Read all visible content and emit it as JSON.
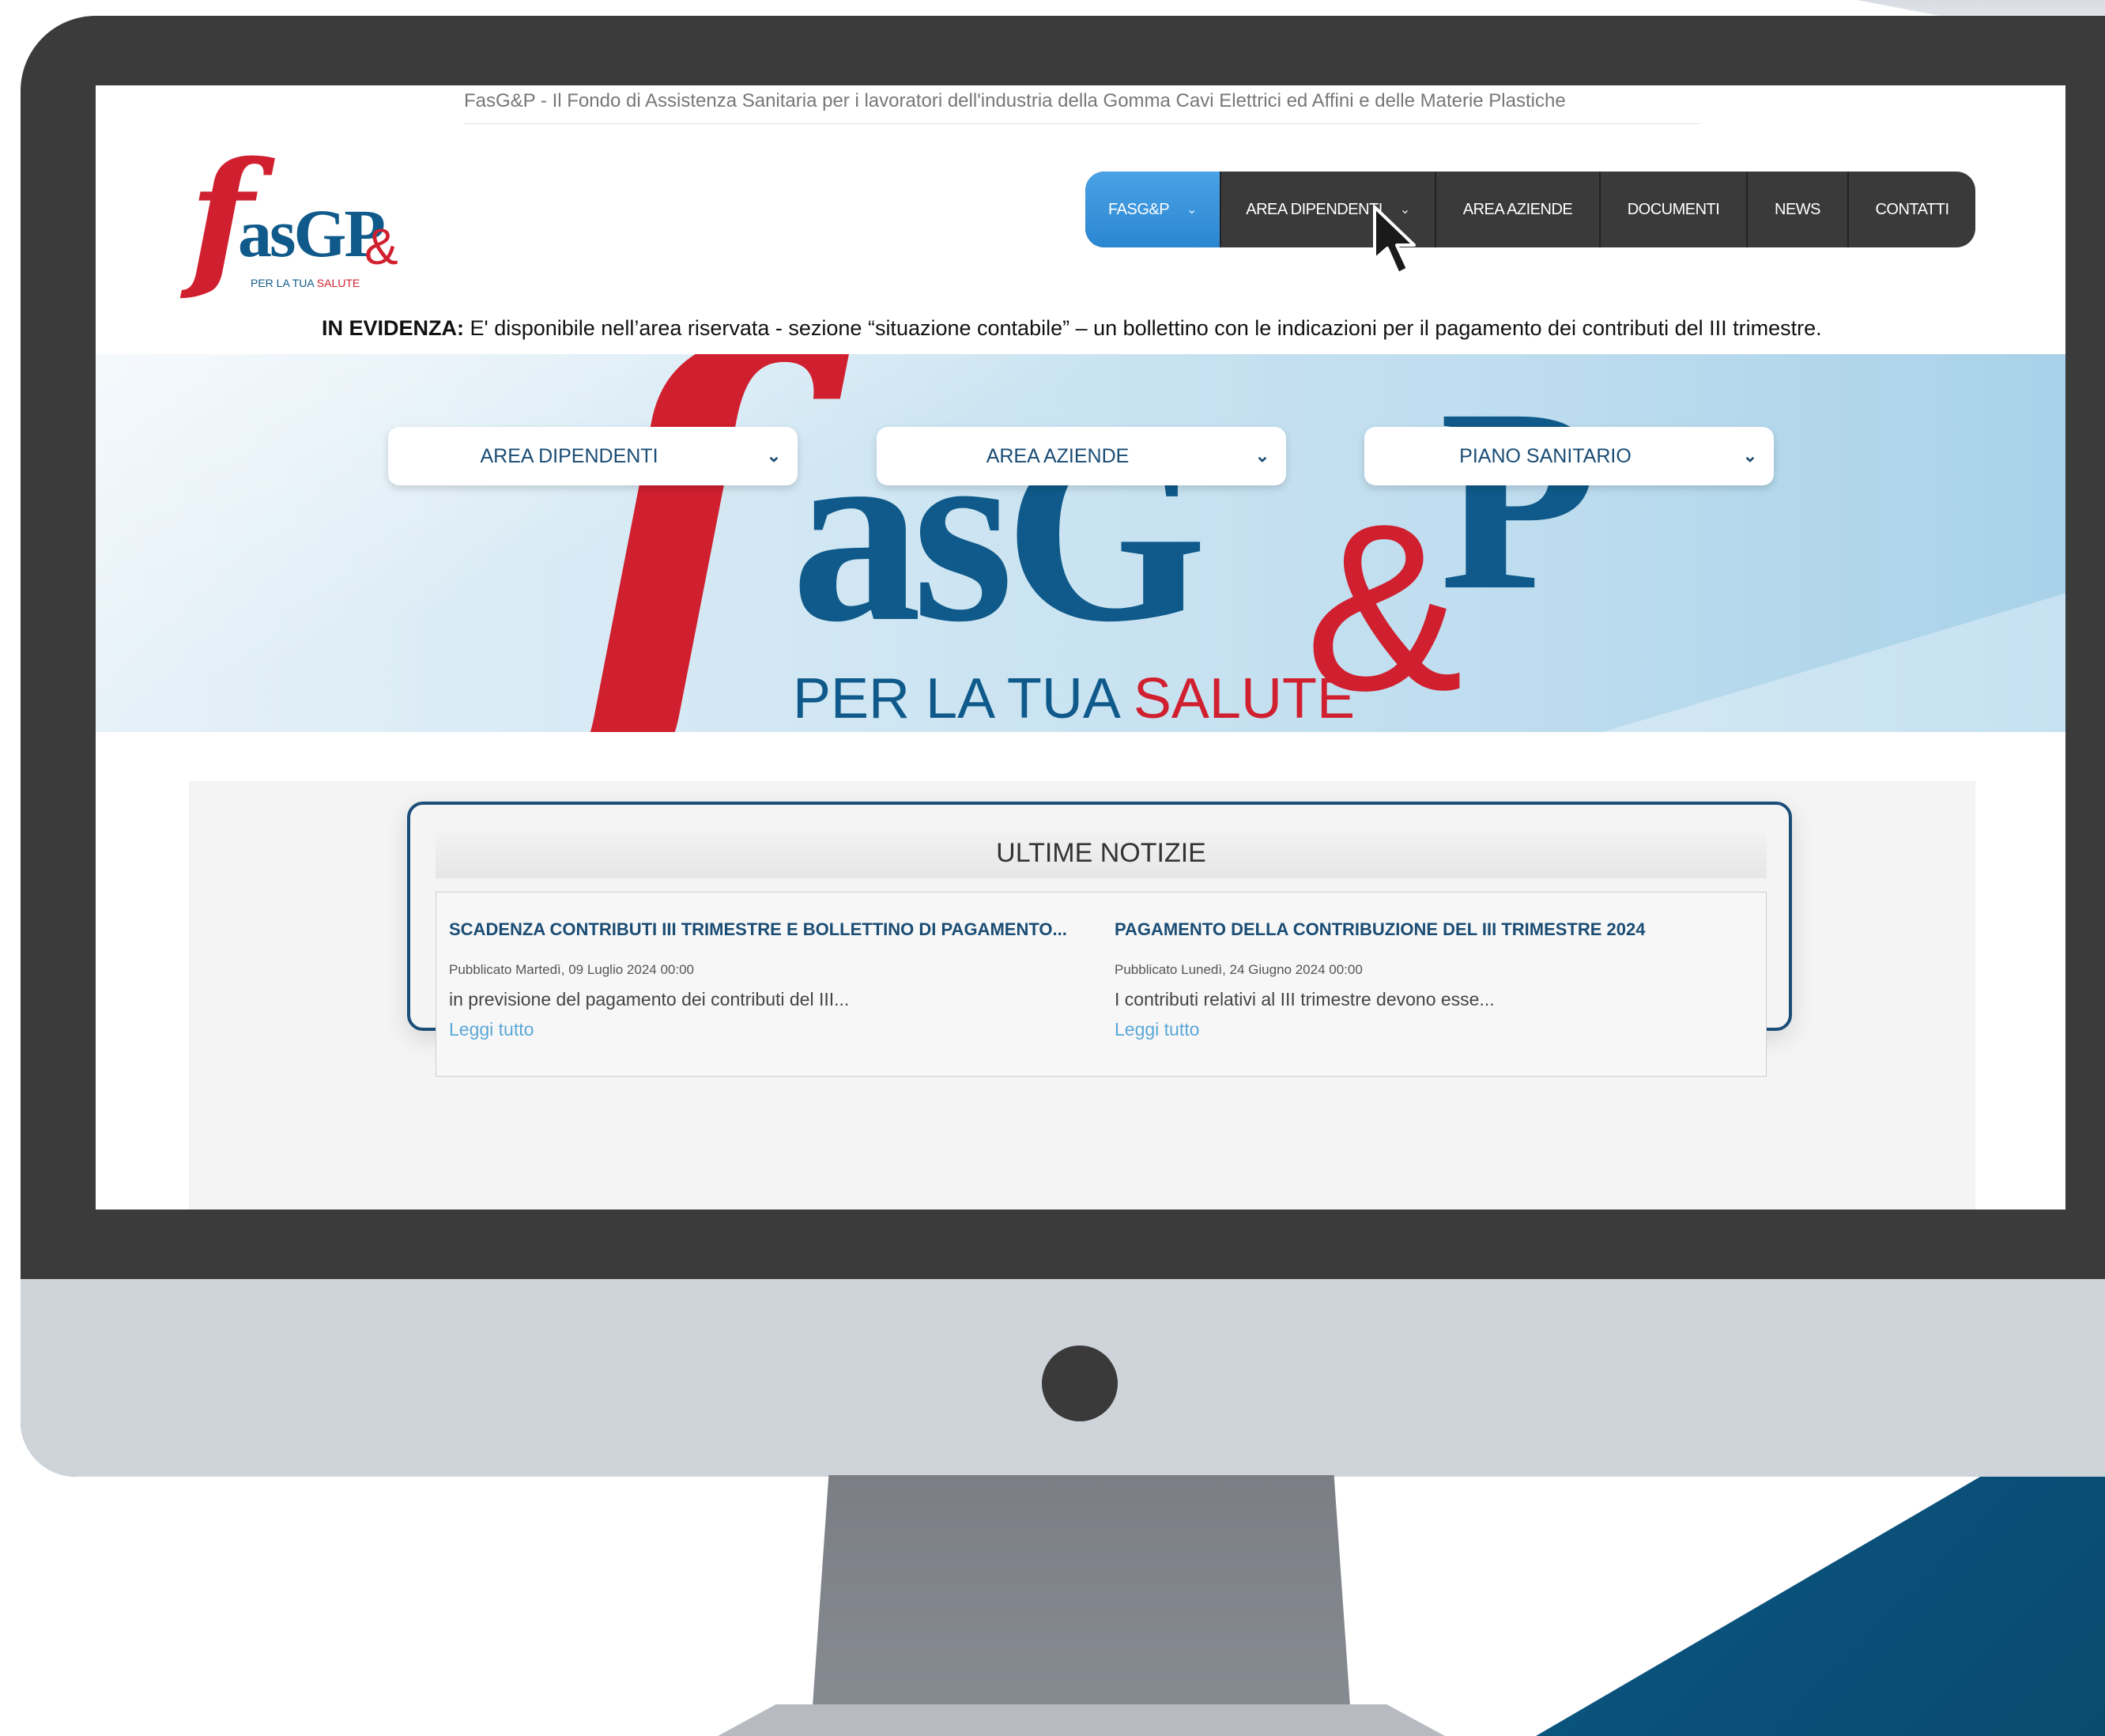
{
  "site": {
    "tagline": "FasG&P - Il Fondo di Assistenza Sanitaria per i lavoratori dell'industria della Gomma Cavi Elettrici ed Affini e delle Materie Plastiche",
    "logo": {
      "f": "f",
      "text": "asG",
      "amp": "&",
      "p": "P",
      "sub_blue": "PER LA TUA ",
      "sub_red": "SALUTE"
    }
  },
  "nav": {
    "items": [
      {
        "label": "FASG&P",
        "chevron": "⌄"
      },
      {
        "label": "AREA DIPENDENTI",
        "chevron": "⌄"
      },
      {
        "label": "AREA AZIENDE"
      },
      {
        "label": "DOCUMENTI"
      },
      {
        "label": "NEWS"
      },
      {
        "label": "CONTATTI"
      }
    ]
  },
  "evidenza": {
    "label": "IN EVIDENZA:",
    "text": "E' disponibile nell’area riservata - sezione “situazione contabile” – un bollettino con le indicazioni per il pagamento dei contributi del III trimestre."
  },
  "hero": {
    "dropdowns": [
      {
        "label": "AREA DIPENDENTI"
      },
      {
        "label": "AREA AZIENDE"
      },
      {
        "label": "PIANO SANITARIO"
      }
    ],
    "chevron": "⌄"
  },
  "news": {
    "title": "ULTIME NOTIZIE",
    "articles": [
      {
        "title": "SCADENZA CONTRIBUTI III TRIMESTRE E BOLLETTINO DI PAGAMENTO...",
        "date": "Pubblicato Martedì, 09 Luglio 2024 00:00",
        "excerpt": "in previsione del pagamento dei contributi del III...",
        "link": "Leggi tutto"
      },
      {
        "title": "PAGAMENTO DELLA CONTRIBUZIONE DEL III TRIMESTRE 2024",
        "date": "Pubblicato Lunedì, 24 Giugno 2024 00:00",
        "excerpt": "I contributi relativi al III trimestre devono esse...",
        "link": "Leggi tutto"
      }
    ]
  },
  "colors": {
    "brand_red": "#d0202f",
    "brand_blue": "#0f5a8a",
    "nav_active": "#2b86d2",
    "nav_bg": "#3a3a3a"
  },
  "icons": [
    "chevron-down-icon",
    "mouse-cursor-icon",
    "camera-icon"
  ]
}
